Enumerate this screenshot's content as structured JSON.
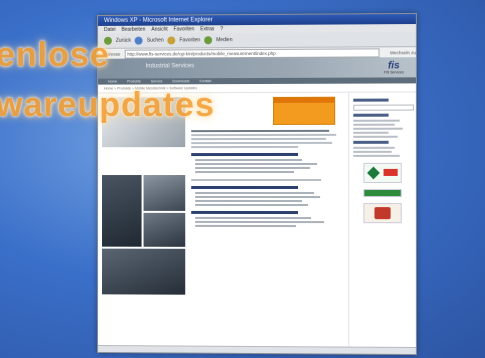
{
  "overlay": {
    "line1": "enlose",
    "line2": "wareupdates"
  },
  "browser": {
    "title": "Windows XP - Microsoft Internet Explorer",
    "menu": [
      "Datei",
      "Bearbeiten",
      "Ansicht",
      "Favoriten",
      "Extras",
      "?"
    ],
    "toolbar": [
      "Zurück",
      "Suchen",
      "Favoriten",
      "Medien"
    ],
    "address_label": "Adresse",
    "address_value": "http://www.fis-services.de/cgi-bin/products/mobile_measurement/index.php",
    "go_label": "Wechseln zu"
  },
  "site": {
    "title": "Industrial Services",
    "logo": "fis",
    "logo_sub": "FIS Services",
    "nav": [
      "Home",
      "Produkte",
      "Service",
      "Downloads",
      "Kontakt"
    ],
    "breadcrumb": "Home > Produkte > Mobile Messtechnik > Software Updates"
  },
  "colors": {
    "overlay": "#f4a23a",
    "site_header": "#7f8f9e",
    "accent_box": "#f39b1f",
    "background": "#3a63b4"
  }
}
